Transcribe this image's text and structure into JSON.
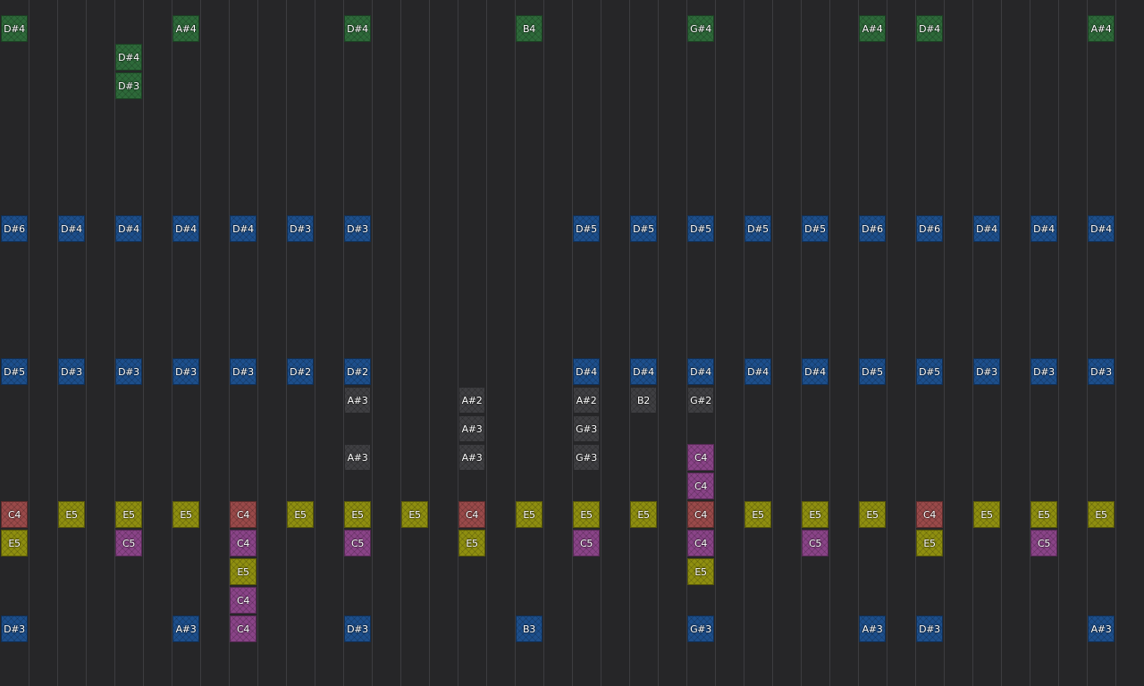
{
  "colors": {
    "background": "#262628",
    "grid_line": "#3c3c40",
    "green": "#2e6a3a",
    "blue": "#1d4f8c",
    "gray": "#3f3f42",
    "purple": "#8a4488",
    "yellow": "#8f8f10",
    "red": "#9a4a4a"
  },
  "notes": [
    {
      "label": "D#4",
      "col": 0,
      "row": 1,
      "color": "green"
    },
    {
      "label": "A#4",
      "col": 3,
      "row": 1,
      "color": "green"
    },
    {
      "label": "D#4",
      "col": 6,
      "row": 1,
      "color": "green"
    },
    {
      "label": "B4",
      "col": 9,
      "row": 1,
      "color": "green"
    },
    {
      "label": "G#4",
      "col": 12,
      "row": 1,
      "color": "green"
    },
    {
      "label": "A#4",
      "col": 15,
      "row": 1,
      "color": "green"
    },
    {
      "label": "D#4",
      "col": 16,
      "row": 1,
      "color": "green"
    },
    {
      "label": "A#4",
      "col": 19,
      "row": 1,
      "color": "green"
    },
    {
      "label": "D#4",
      "col": 2,
      "row": 2,
      "color": "green"
    },
    {
      "label": "D#3",
      "col": 2,
      "row": 3,
      "color": "green"
    },
    {
      "label": "D#6",
      "col": 0,
      "row": 8,
      "color": "blue"
    },
    {
      "label": "D#4",
      "col": 1,
      "row": 8,
      "color": "blue"
    },
    {
      "label": "D#4",
      "col": 2,
      "row": 8,
      "color": "blue"
    },
    {
      "label": "D#4",
      "col": 3,
      "row": 8,
      "color": "blue"
    },
    {
      "label": "D#4",
      "col": 4,
      "row": 8,
      "color": "blue"
    },
    {
      "label": "D#3",
      "col": 5,
      "row": 8,
      "color": "blue"
    },
    {
      "label": "D#3",
      "col": 6,
      "row": 8,
      "color": "blue"
    },
    {
      "label": "D#5",
      "col": 10,
      "row": 8,
      "color": "blue"
    },
    {
      "label": "D#5",
      "col": 11,
      "row": 8,
      "color": "blue"
    },
    {
      "label": "D#5",
      "col": 12,
      "row": 8,
      "color": "blue"
    },
    {
      "label": "D#5",
      "col": 13,
      "row": 8,
      "color": "blue"
    },
    {
      "label": "D#5",
      "col": 14,
      "row": 8,
      "color": "blue"
    },
    {
      "label": "D#6",
      "col": 15,
      "row": 8,
      "color": "blue"
    },
    {
      "label": "D#6",
      "col": 16,
      "row": 8,
      "color": "blue"
    },
    {
      "label": "D#4",
      "col": 17,
      "row": 8,
      "color": "blue"
    },
    {
      "label": "D#4",
      "col": 18,
      "row": 8,
      "color": "blue"
    },
    {
      "label": "D#4",
      "col": 19,
      "row": 8,
      "color": "blue"
    },
    {
      "label": "D#5",
      "col": 0,
      "row": 13,
      "color": "blue"
    },
    {
      "label": "D#3",
      "col": 1,
      "row": 13,
      "color": "blue"
    },
    {
      "label": "D#3",
      "col": 2,
      "row": 13,
      "color": "blue"
    },
    {
      "label": "D#3",
      "col": 3,
      "row": 13,
      "color": "blue"
    },
    {
      "label": "D#3",
      "col": 4,
      "row": 13,
      "color": "blue"
    },
    {
      "label": "D#2",
      "col": 5,
      "row": 13,
      "color": "blue"
    },
    {
      "label": "D#2",
      "col": 6,
      "row": 13,
      "color": "blue"
    },
    {
      "label": "D#4",
      "col": 10,
      "row": 13,
      "color": "blue"
    },
    {
      "label": "D#4",
      "col": 11,
      "row": 13,
      "color": "blue"
    },
    {
      "label": "D#4",
      "col": 12,
      "row": 13,
      "color": "blue"
    },
    {
      "label": "D#4",
      "col": 13,
      "row": 13,
      "color": "blue"
    },
    {
      "label": "D#4",
      "col": 14,
      "row": 13,
      "color": "blue"
    },
    {
      "label": "D#5",
      "col": 15,
      "row": 13,
      "color": "blue"
    },
    {
      "label": "D#5",
      "col": 16,
      "row": 13,
      "color": "blue"
    },
    {
      "label": "D#3",
      "col": 17,
      "row": 13,
      "color": "blue"
    },
    {
      "label": "D#3",
      "col": 18,
      "row": 13,
      "color": "blue"
    },
    {
      "label": "D#3",
      "col": 19,
      "row": 13,
      "color": "blue"
    },
    {
      "label": "A#3",
      "col": 6,
      "row": 14,
      "color": "gray"
    },
    {
      "label": "A#2",
      "col": 8,
      "row": 14,
      "color": "gray"
    },
    {
      "label": "A#2",
      "col": 10,
      "row": 14,
      "color": "gray"
    },
    {
      "label": "B2",
      "col": 11,
      "row": 14,
      "color": "gray"
    },
    {
      "label": "G#2",
      "col": 12,
      "row": 14,
      "color": "gray"
    },
    {
      "label": "A#3",
      "col": 8,
      "row": 15,
      "color": "gray"
    },
    {
      "label": "G#3",
      "col": 10,
      "row": 15,
      "color": "gray"
    },
    {
      "label": "A#3",
      "col": 6,
      "row": 16,
      "color": "gray"
    },
    {
      "label": "A#3",
      "col": 8,
      "row": 16,
      "color": "gray"
    },
    {
      "label": "G#3",
      "col": 10,
      "row": 16,
      "color": "gray"
    },
    {
      "label": "C4",
      "col": 12,
      "row": 16,
      "color": "purple"
    },
    {
      "label": "C4",
      "col": 12,
      "row": 17,
      "color": "purple"
    },
    {
      "label": "C4",
      "col": 0,
      "row": 18,
      "color": "red"
    },
    {
      "label": "E5",
      "col": 1,
      "row": 18,
      "color": "yellow"
    },
    {
      "label": "E5",
      "col": 2,
      "row": 18,
      "color": "yellow"
    },
    {
      "label": "E5",
      "col": 3,
      "row": 18,
      "color": "yellow"
    },
    {
      "label": "C4",
      "col": 4,
      "row": 18,
      "color": "red"
    },
    {
      "label": "E5",
      "col": 5,
      "row": 18,
      "color": "yellow"
    },
    {
      "label": "E5",
      "col": 6,
      "row": 18,
      "color": "yellow"
    },
    {
      "label": "E5",
      "col": 7,
      "row": 18,
      "color": "yellow"
    },
    {
      "label": "C4",
      "col": 8,
      "row": 18,
      "color": "red"
    },
    {
      "label": "E5",
      "col": 9,
      "row": 18,
      "color": "yellow"
    },
    {
      "label": "E5",
      "col": 10,
      "row": 18,
      "color": "yellow"
    },
    {
      "label": "E5",
      "col": 11,
      "row": 18,
      "color": "yellow"
    },
    {
      "label": "C4",
      "col": 12,
      "row": 18,
      "color": "red"
    },
    {
      "label": "E5",
      "col": 13,
      "row": 18,
      "color": "yellow"
    },
    {
      "label": "E5",
      "col": 14,
      "row": 18,
      "color": "yellow"
    },
    {
      "label": "E5",
      "col": 15,
      "row": 18,
      "color": "yellow"
    },
    {
      "label": "C4",
      "col": 16,
      "row": 18,
      "color": "red"
    },
    {
      "label": "E5",
      "col": 17,
      "row": 18,
      "color": "yellow"
    },
    {
      "label": "E5",
      "col": 18,
      "row": 18,
      "color": "yellow"
    },
    {
      "label": "E5",
      "col": 19,
      "row": 18,
      "color": "yellow"
    },
    {
      "label": "E5",
      "col": 0,
      "row": 19,
      "color": "yellow"
    },
    {
      "label": "C5",
      "col": 2,
      "row": 19,
      "color": "purple"
    },
    {
      "label": "C4",
      "col": 4,
      "row": 19,
      "color": "purple"
    },
    {
      "label": "C5",
      "col": 6,
      "row": 19,
      "color": "purple"
    },
    {
      "label": "E5",
      "col": 8,
      "row": 19,
      "color": "yellow"
    },
    {
      "label": "C5",
      "col": 10,
      "row": 19,
      "color": "purple"
    },
    {
      "label": "C4",
      "col": 12,
      "row": 19,
      "color": "purple"
    },
    {
      "label": "C5",
      "col": 14,
      "row": 19,
      "color": "purple"
    },
    {
      "label": "E5",
      "col": 16,
      "row": 19,
      "color": "yellow"
    },
    {
      "label": "C5",
      "col": 18,
      "row": 19,
      "color": "purple"
    },
    {
      "label": "E5",
      "col": 4,
      "row": 20,
      "color": "yellow"
    },
    {
      "label": "E5",
      "col": 12,
      "row": 20,
      "color": "yellow"
    },
    {
      "label": "C4",
      "col": 4,
      "row": 21,
      "color": "purple"
    },
    {
      "label": "D#3",
      "col": 0,
      "row": 22,
      "color": "blue"
    },
    {
      "label": "A#3",
      "col": 3,
      "row": 22,
      "color": "blue"
    },
    {
      "label": "C4",
      "col": 4,
      "row": 22,
      "color": "purple"
    },
    {
      "label": "D#3",
      "col": 6,
      "row": 22,
      "color": "blue"
    },
    {
      "label": "B3",
      "col": 9,
      "row": 22,
      "color": "blue"
    },
    {
      "label": "G#3",
      "col": 12,
      "row": 22,
      "color": "blue"
    },
    {
      "label": "A#3",
      "col": 15,
      "row": 22,
      "color": "blue"
    },
    {
      "label": "D#3",
      "col": 16,
      "row": 22,
      "color": "blue"
    },
    {
      "label": "A#3",
      "col": 19,
      "row": 22,
      "color": "blue"
    }
  ]
}
